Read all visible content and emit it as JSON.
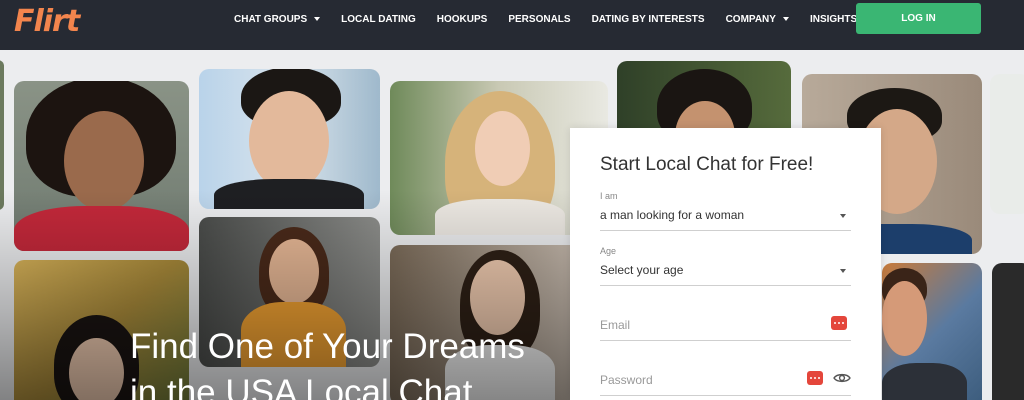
{
  "brand": {
    "logo_text": "Flirt",
    "logo_color": "#f3854d"
  },
  "nav": {
    "items": [
      {
        "label": "CHAT GROUPS",
        "has_dropdown": true
      },
      {
        "label": "LOCAL DATING",
        "has_dropdown": false
      },
      {
        "label": "HOOKUPS",
        "has_dropdown": false
      },
      {
        "label": "PERSONALS",
        "has_dropdown": false
      },
      {
        "label": "DATING BY INTERESTS",
        "has_dropdown": false
      },
      {
        "label": "COMPANY",
        "has_dropdown": true
      },
      {
        "label": "INSIGHTS",
        "has_dropdown": true
      }
    ],
    "login_label": "LOG IN",
    "login_color": "#3ab673"
  },
  "hero": {
    "headline_line1": "Find One of Your Dreams",
    "headline_line2": "in the USA Local Chat"
  },
  "form": {
    "title": "Start Local Chat for Free!",
    "iam": {
      "label": "I am",
      "value": "a man looking for a woman"
    },
    "age": {
      "label": "Age",
      "value": "Select your age"
    },
    "email": {
      "placeholder": "Email",
      "icon": "password-manager-icon"
    },
    "password": {
      "placeholder": "Password",
      "icon": "password-manager-icon",
      "toggle_icon": "eye-icon"
    }
  }
}
